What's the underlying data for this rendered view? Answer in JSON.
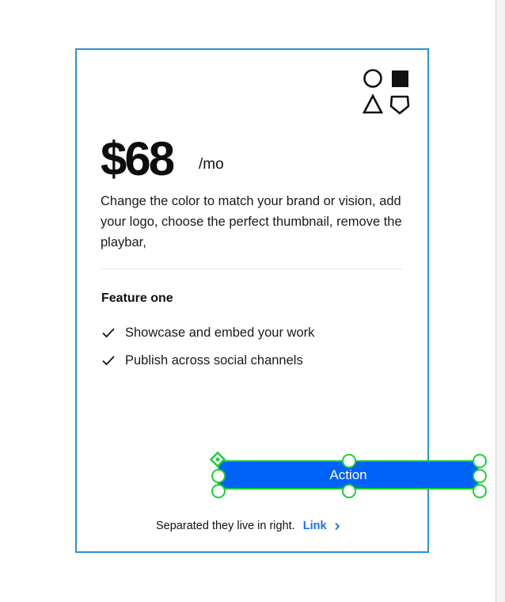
{
  "pricing_card": {
    "price": "$68",
    "period": "/mo",
    "description": "Change the color to match your brand or vision, add your logo, choose the perfect thumbnail, remove the playbar,",
    "feature_heading": "Feature one",
    "features": [
      {
        "label": "Showcase and embed your work",
        "icon": "checkmark-icon"
      },
      {
        "label": "Publish across social channels",
        "icon": "checkmark-icon"
      }
    ],
    "shapes_icon": "shapes-icon",
    "action_label": "Action",
    "footer_text": "Separated they live in right.",
    "footer_link": "Link"
  },
  "colors": {
    "card_border": "#2b8fd9",
    "action_background": "#0063f7",
    "selection_handles": "#1ccf3a",
    "link": "#1473e6"
  }
}
